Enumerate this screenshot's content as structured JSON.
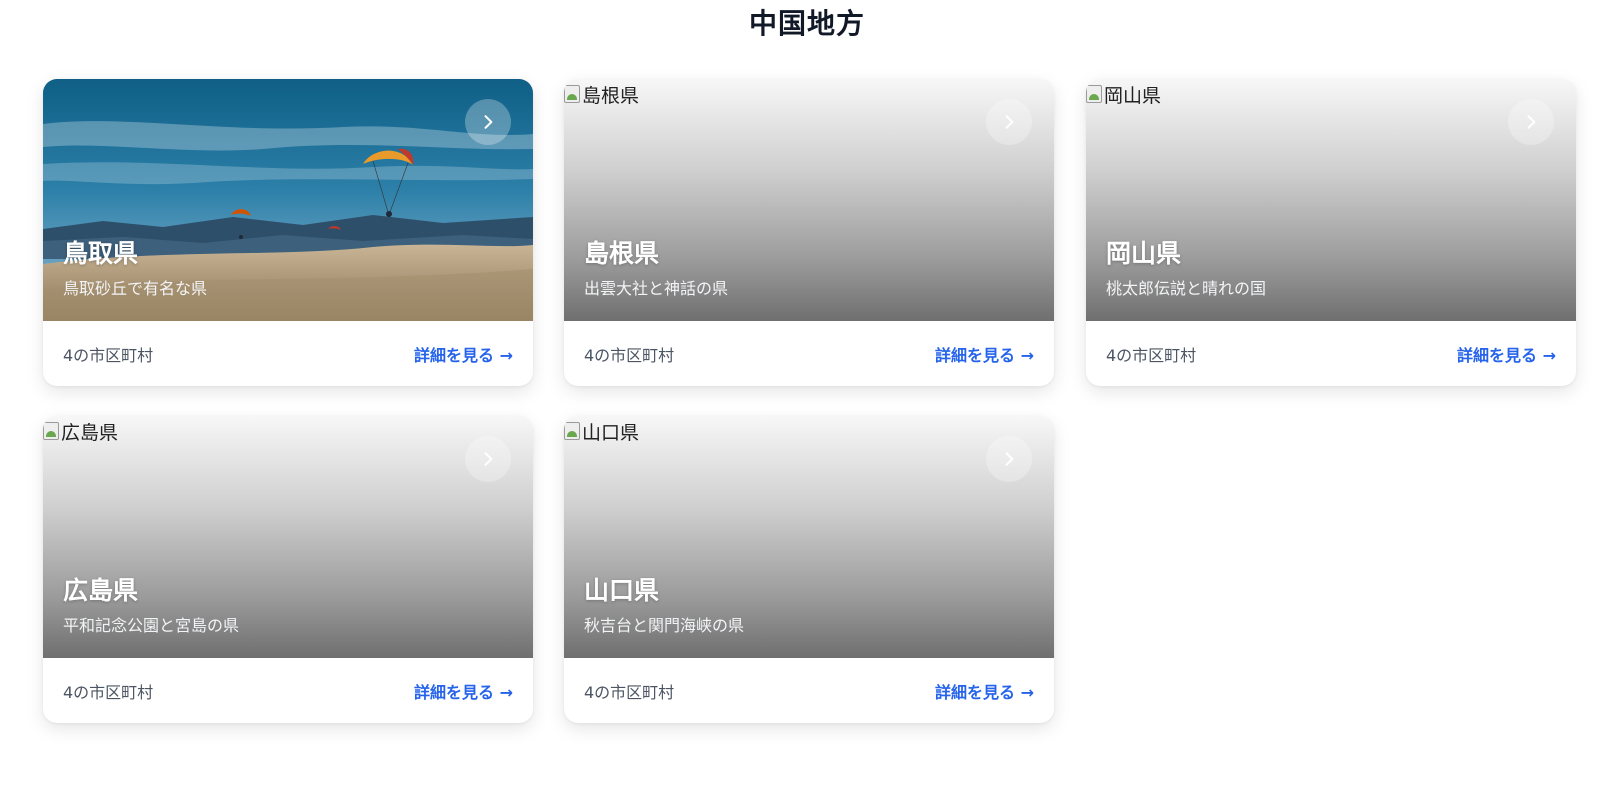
{
  "region": {
    "title": "中国地方"
  },
  "cards": [
    {
      "name": "鳥取県",
      "description": "鳥取砂丘で有名な県",
      "image_alt": "",
      "has_photo": true,
      "count": "4の市区町村",
      "link": "詳細を見る →"
    },
    {
      "name": "島根県",
      "description": "出雲大社と神話の県",
      "image_alt": "島根県",
      "has_photo": false,
      "count": "4の市区町村",
      "link": "詳細を見る →"
    },
    {
      "name": "岡山県",
      "description": "桃太郎伝説と晴れの国",
      "image_alt": "岡山県",
      "has_photo": false,
      "count": "4の市区町村",
      "link": "詳細を見る →"
    },
    {
      "name": "広島県",
      "description": "平和記念公園と宮島の県",
      "image_alt": "広島県",
      "has_photo": false,
      "count": "4の市区町村",
      "link": "詳細を見る →"
    },
    {
      "name": "山口県",
      "description": "秋吉台と関門海峡の県",
      "image_alt": "山口県",
      "has_photo": false,
      "count": "4の市区町村",
      "link": "詳細を見る →"
    }
  ],
  "colors": {
    "link": "#2563eb",
    "muted": "#4b5563",
    "title": "#111827"
  },
  "icons": {
    "card_arrow": "chevron-right-icon",
    "broken_image": "broken-image-icon"
  }
}
